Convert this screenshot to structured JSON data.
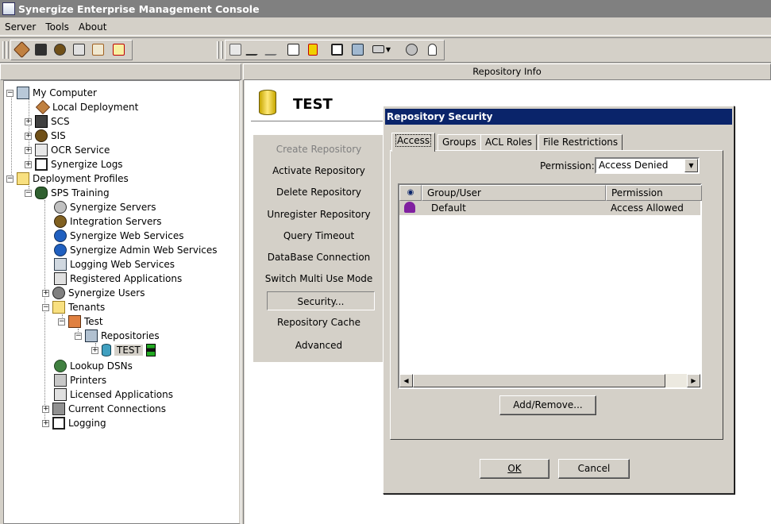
{
  "window": {
    "title": "Synergize Enterprise Management Console"
  },
  "menu": {
    "items": [
      "Server",
      "Tools",
      "About"
    ]
  },
  "toolbar": {
    "icons": [
      "deploy-icon",
      "binoculars-icon",
      "globe-icon",
      "book-icon",
      "checklist-icon",
      "certificate-icon",
      "new-server-icon",
      "route-icon",
      "route2-icon",
      "flag-icon",
      "document-icon",
      "monitor-icon",
      "computer-icon",
      "network-icon",
      "gear-run-icon",
      "lock-icon"
    ]
  },
  "panes": {
    "right_header": "Repository Info"
  },
  "tree": {
    "my_computer": "My Computer",
    "local_deployment": "Local Deployment",
    "scs": "SCS",
    "sis": "SIS",
    "ocr_service": "OCR Service",
    "synergize_logs": "Synergize Logs",
    "deployment_profiles": "Deployment Profiles",
    "sps_training": "SPS Training",
    "synergize_servers": "Synergize Servers",
    "integration_servers": "Integration Servers",
    "synergize_web_services": "Synergize Web Services",
    "synergize_admin_web_services": "Synergize Admin Web Services",
    "logging_web_services": "Logging Web Services",
    "registered_applications": "Registered Applications",
    "synergize_users": "Synergize Users",
    "tenants": "Tenants",
    "test_tenant": "Test",
    "repositories": "Repositories",
    "test_repo": "TEST",
    "lookup_dsns": "Lookup DSNs",
    "printers": "Printers",
    "licensed_applications": "Licensed Applications",
    "current_connections": "Current Connections",
    "logging": "Logging"
  },
  "repository": {
    "name": "TEST",
    "actions": [
      {
        "label": "Create Repository",
        "enabled": false
      },
      {
        "label": "Activate Repository",
        "enabled": true
      },
      {
        "label": "Delete Repository",
        "enabled": true
      },
      {
        "label": "Unregister Repository",
        "enabled": true
      },
      {
        "label": "Query Timeout",
        "enabled": true
      },
      {
        "label": "DataBase Connection",
        "enabled": true
      },
      {
        "label": "Switch Multi Use Mode",
        "enabled": true
      },
      {
        "label": "Security...",
        "enabled": true
      },
      {
        "label": "Repository Cache",
        "enabled": true
      },
      {
        "label": "Advanced",
        "enabled": true
      }
    ]
  },
  "dialog": {
    "title": "Repository Security",
    "tabs": [
      "Access",
      "Groups",
      "ACL Roles",
      "File Restrictions"
    ],
    "active_tab": "Access",
    "permission_label": "Permission:",
    "permission_value": "Access Denied",
    "columns": [
      "Group/User",
      "Permission"
    ],
    "rows": [
      {
        "name": "Default",
        "permission": "Access Allowed"
      }
    ],
    "add_remove": "Add/Remove...",
    "ok": "OK",
    "cancel": "Cancel"
  }
}
